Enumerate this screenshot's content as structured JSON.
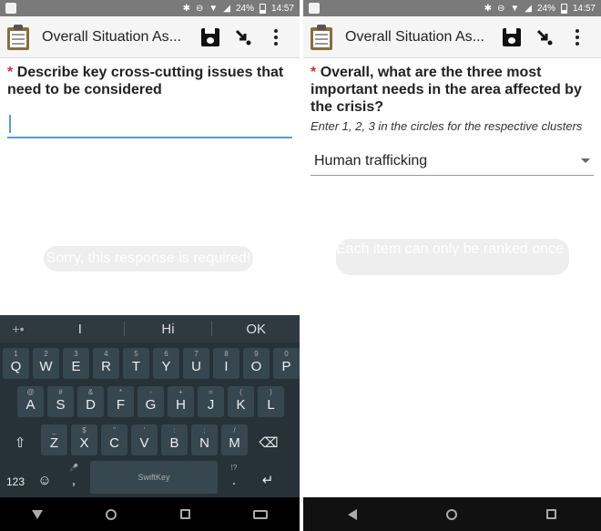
{
  "left": {
    "status": {
      "battery": "24%",
      "time": "14:57"
    },
    "toolbar": {
      "title": "Overall Situation As..."
    },
    "question": {
      "required_mark": "*",
      "text": "Describe key cross-cutting issues that need to be considered"
    },
    "toast": "Sorry, this response is required!",
    "keyboard": {
      "suggestions": [
        "I",
        "Hi",
        "OK"
      ],
      "row1": [
        {
          "k": "Q",
          "n": "1"
        },
        {
          "k": "W",
          "n": "2"
        },
        {
          "k": "E",
          "n": "3"
        },
        {
          "k": "R",
          "n": "4"
        },
        {
          "k": "T",
          "n": "5"
        },
        {
          "k": "Y",
          "n": "6"
        },
        {
          "k": "U",
          "n": "7"
        },
        {
          "k": "I",
          "n": "8"
        },
        {
          "k": "O",
          "n": "9"
        },
        {
          "k": "P",
          "n": "0"
        }
      ],
      "row2": [
        {
          "k": "A",
          "n": "@"
        },
        {
          "k": "S",
          "n": "#"
        },
        {
          "k": "D",
          "n": "&"
        },
        {
          "k": "F",
          "n": "*"
        },
        {
          "k": "G",
          "n": "-"
        },
        {
          "k": "H",
          "n": "+"
        },
        {
          "k": "J",
          "n": "="
        },
        {
          "k": "K",
          "n": "("
        },
        {
          "k": "L",
          "n": ")"
        }
      ],
      "row3": [
        {
          "k": "Z",
          "n": "_"
        },
        {
          "k": "X",
          "n": "$"
        },
        {
          "k": "C",
          "n": "\""
        },
        {
          "k": "V",
          "n": "'"
        },
        {
          "k": "B",
          "n": ":"
        },
        {
          "k": "N",
          "n": ";"
        },
        {
          "k": "M",
          "n": "/"
        }
      ],
      "numbers_key": "123",
      "space_label": "SwiftKey"
    }
  },
  "right": {
    "status": {
      "battery": "24%",
      "time": "14:57"
    },
    "toolbar": {
      "title": "Overall Situation As..."
    },
    "question": {
      "required_mark": "*",
      "text": "Overall, what are the three most important needs in the area affected by the crisis?"
    },
    "hint": "Enter 1, 2, 3 in the circles for the respective clusters",
    "select": {
      "value": "Human trafficking"
    },
    "toast": "Each item can only be ranked once"
  },
  "colors": {
    "accent": "#5b9bd5",
    "required": "#d32f2f",
    "toolbar_bg": "#f5f5f5",
    "keyboard_bg": "#263238"
  }
}
